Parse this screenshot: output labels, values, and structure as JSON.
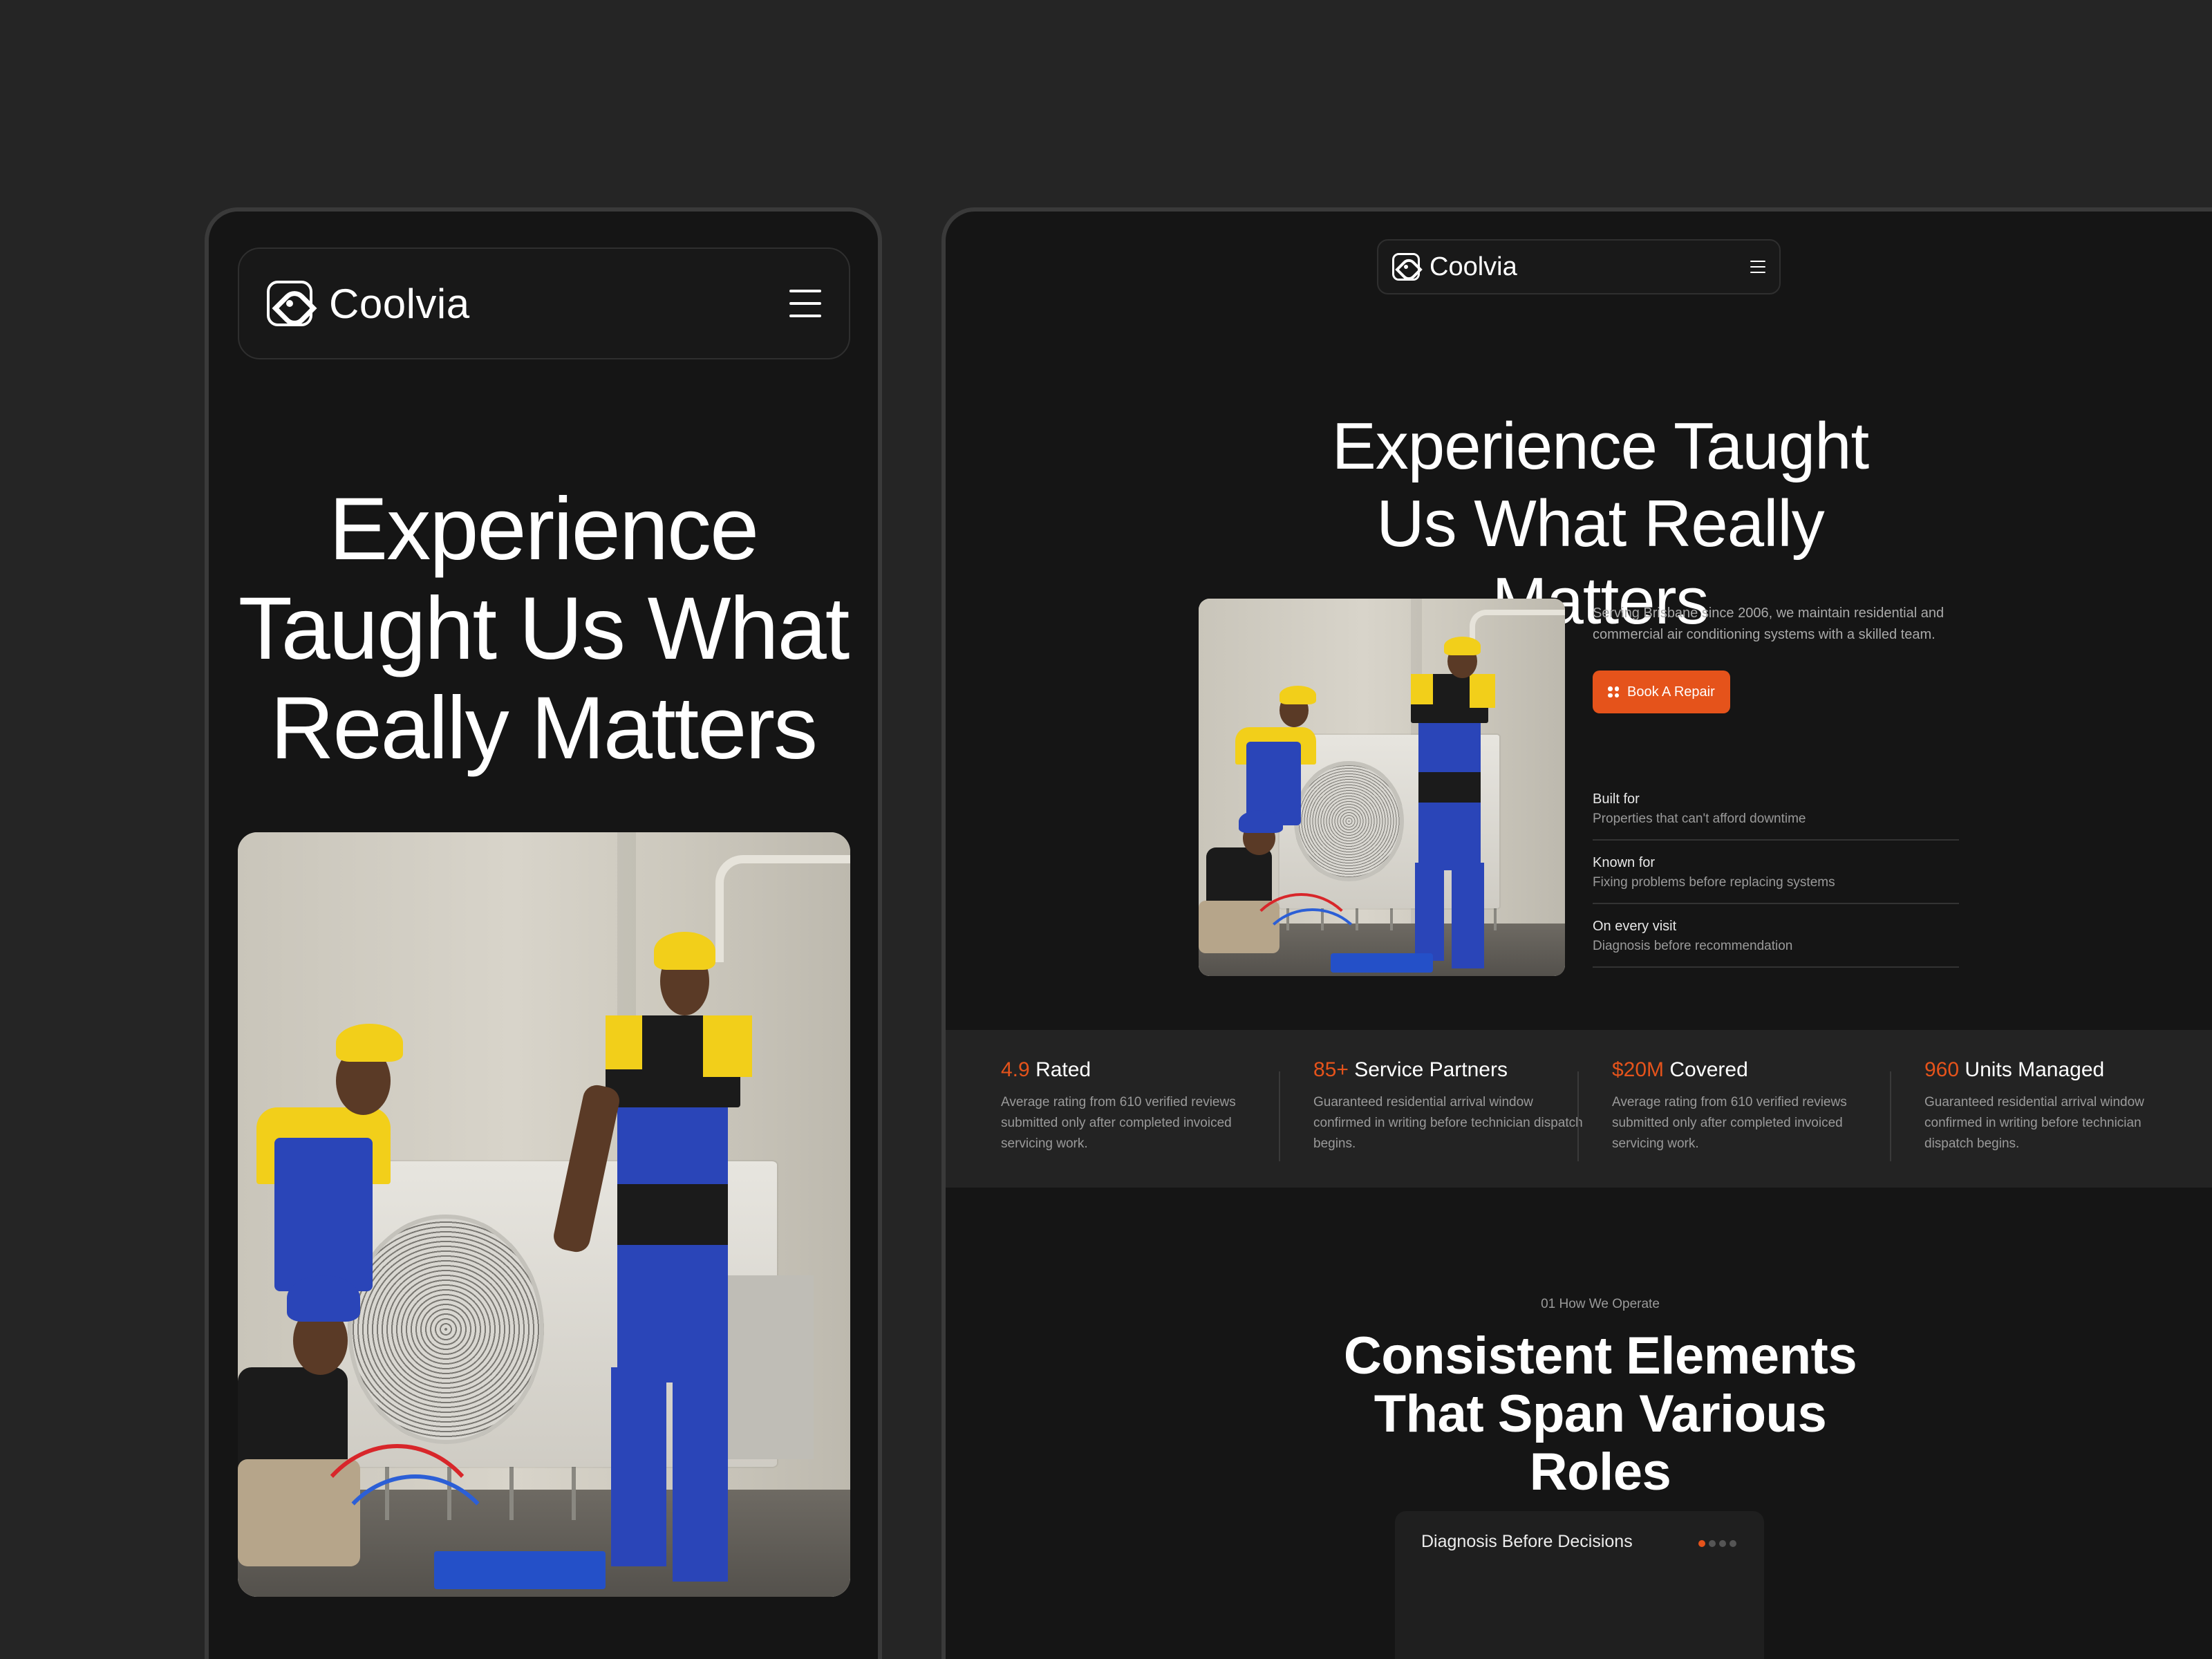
{
  "brand": {
    "name": "Coolvia",
    "accent_color": "#e5531b"
  },
  "nav": {
    "menu_icon": "hamburger-menu-icon",
    "logo_icon": "fan-logo-icon"
  },
  "hero": {
    "title": "Experience Taught Us What Really Matters",
    "description": "Serving Brisbane since 2006, we maintain residential and commercial air conditioning systems with a skilled team.",
    "cta_label": "Book A Repair",
    "cta_icon": "grid-dots-icon",
    "facts": [
      {
        "label": "Built for",
        "text": "Properties that can't afford downtime"
      },
      {
        "label": "Known for",
        "text": "Fixing problems before replacing systems"
      },
      {
        "label": "On every visit",
        "text": "Diagnosis before recommendation"
      }
    ]
  },
  "stats": [
    {
      "value": "4.9",
      "label": "Rated",
      "text": "Average rating from 610 verified reviews submitted only after completed invoiced servicing work."
    },
    {
      "value": "85+",
      "label": "Service Partners",
      "text": "Guaranteed residential arrival window confirmed in writing before technician dispatch begins."
    },
    {
      "value": "$20M",
      "label": "Covered",
      "text": "Average rating from 610 verified reviews submitted only after completed invoiced servicing work."
    },
    {
      "value": "960",
      "label": "Units Managed",
      "text": "Guaranteed residential arrival window confirmed in writing before technician dispatch begins."
    }
  ],
  "operate": {
    "kicker": "01 How We Operate",
    "title": "Consistent Elements That Span Various Roles",
    "card_title": "Diagnosis Before Decisions",
    "card_pages": 4,
    "card_active_page": 1
  }
}
